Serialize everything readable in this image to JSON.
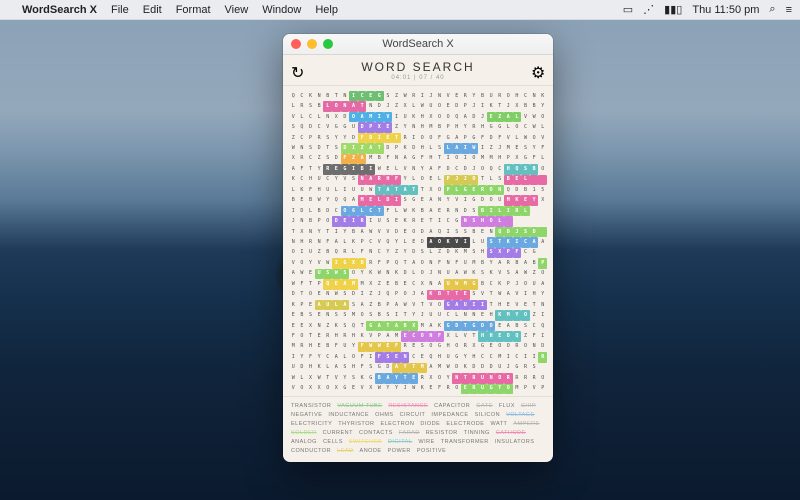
{
  "menubar": {
    "apple_glyph": "",
    "app_name": "WordSearch X",
    "menus": [
      "File",
      "Edit",
      "Format",
      "View",
      "Window",
      "Help"
    ],
    "status_wifi": "⋰",
    "status_airplay": "▭",
    "status_battery": "▮▮▯",
    "status_time": "Thu 11:50 pm",
    "status_search": "⌕",
    "status_menu": "≡"
  },
  "window": {
    "title": "WordSearch X",
    "toolbar_title": "WORD SEARCH",
    "toolbar_sub": "04:01  |  07 / 40",
    "refresh_icon": "↻",
    "gear_icon": "⚙"
  },
  "grid": {
    "cols": 30,
    "rows_text": [
      "QCKNBTNICEGSZWRIJNVERYBUROHCNKE",
      "LRSBLONATNDJZXLWUOEDPJIKTJXBBYU",
      "VLCLNXDOAMIVIUKHXOOQADJEZALVWOQOQCU",
      "SQDCVGGUDPXEZYNHMBPHYRHGGLOCWLPR",
      "ZCPRSYYDFDIETRIOOFGAPGFDFVLWOVHUUX",
      "WNSDTSDIZATDPKDHLSLAIWIZJMESYFVTOU",
      "XRCZSDFZAMBFNAGFHTIOIOMMHPXGFLA",
      "AFTYREGIBIWELVNYAFDCDJOQCHQSBOUL",
      "KCHUCYVSNARHFYLOELPJJOTLSBEL",
      "LKFHULIUUWTATATTXOPLGERONQDB15FZ",
      "BEBWYQQAMELDISGEANYVIGDOUMKEYXTJ",
      "IDLBDCO6LCTFLWKBAERNDSBILIRL",
      "JNBPODEIRIUSEKRETICGNSHOL",
      "TXNYTIYBAWVVDEODAQISSBENQDJSD",
      "NHRNFALKPCVQYLEDAOKVILUSTKICAA",
      "OIUZBQRLFNCYZYDSLZDKMSHSXPFCG",
      "VOYVWIGXDRFPQTAONFNFUMBYARBABP",
      "AWEUSWSOYKWNKDLOJNUAWKSKVSAWZOF",
      "WFTPQEAMMXZEBECXNAUWMGBCKPJOUA",
      "DTOENWSDIZJQPOJAKBTTESVTWAVIHY",
      "KPEAULASAZBPAWVTVOGAUIITHEVETNR",
      "EBSENSSMOSBSITYJUUCLNNEHKMYOZIY",
      "EEXNZKSQTGATABXMAKGDTGDOEABSCQ",
      "FOTERHRHKVPAMECONFXLVTHHEOQZFIT",
      "MRHEBFUYFWWEFRESOGHORXGEOORONDGGJG",
      "IYFYCALOFIFSENCEQHUGYHCCMICIIRH",
      "UDHKLASHFSGDAYTMAMWDKDDDUJGRS",
      "WLXWTVYSKGBAYTERXOYNTRUNORRRROB",
      "VOXXOXGEVXWYYJWKEFROERUGTOMPVP"
    ],
    "highlights": [
      {
        "row": 0,
        "col": 7,
        "len": 4,
        "color": "#6fbf73"
      },
      {
        "row": 1,
        "col": 4,
        "len": 5,
        "color": "#e36aa5"
      },
      {
        "row": 2,
        "col": 7,
        "len": 5,
        "color": "#4fb0e6"
      },
      {
        "row": 2,
        "col": 23,
        "len": 4,
        "color": "#7fcf66"
      },
      {
        "row": 3,
        "col": 8,
        "len": 4,
        "color": "#a37de6"
      },
      {
        "row": 4,
        "col": 8,
        "len": 5,
        "color": "#f0d24a"
      },
      {
        "row": 5,
        "col": 6,
        "len": 5,
        "color": "#9ed96a"
      },
      {
        "row": 5,
        "col": 18,
        "len": 4,
        "color": "#6aa8e0"
      },
      {
        "row": 6,
        "col": 6,
        "len": 3,
        "color": "#f0b04a"
      },
      {
        "row": 7,
        "col": 4,
        "len": 6,
        "color": "#6e6e6e"
      },
      {
        "row": 7,
        "col": 25,
        "len": 4,
        "color": "#63c0c0"
      },
      {
        "row": 8,
        "col": 8,
        "len": 5,
        "color": "#e86aa5"
      },
      {
        "row": 8,
        "col": 18,
        "len": 4,
        "color": "#d6ca55"
      },
      {
        "row": 8,
        "col": 25,
        "len": 5,
        "color": "#e86aa5"
      },
      {
        "row": 9,
        "col": 10,
        "len": 5,
        "color": "#63c0c0"
      },
      {
        "row": 9,
        "col": 18,
        "len": 7,
        "color": "#8fd66a"
      },
      {
        "row": 10,
        "col": 8,
        "len": 5,
        "color": "#e86aa5"
      },
      {
        "row": 10,
        "col": 25,
        "len": 4,
        "color": "#e86aa5"
      },
      {
        "row": 11,
        "col": 6,
        "len": 5,
        "color": "#6aa8e0"
      },
      {
        "row": 11,
        "col": 22,
        "len": 6,
        "color": "#8fd66a"
      },
      {
        "row": 12,
        "col": 5,
        "len": 4,
        "color": "#a37de6"
      },
      {
        "row": 12,
        "col": 20,
        "len": 6,
        "color": "#d07de0"
      },
      {
        "row": 13,
        "col": 24,
        "len": 6,
        "color": "#8fd66a"
      },
      {
        "row": 14,
        "col": 16,
        "len": 5,
        "color": "#4a4a4a"
      },
      {
        "row": 14,
        "col": 23,
        "len": 6,
        "color": "#6aa8e0"
      },
      {
        "row": 15,
        "col": 23,
        "len": 4,
        "color": "#a37de6"
      },
      {
        "row": 16,
        "col": 5,
        "len": 4,
        "color": "#f0d24a"
      },
      {
        "row": 16,
        "col": 29,
        "len": 1,
        "color": "#8fd66a"
      },
      {
        "row": 17,
        "col": 3,
        "len": 4,
        "color": "#8fd66a"
      },
      {
        "row": 18,
        "col": 4,
        "len": 4,
        "color": "#f0d24a"
      },
      {
        "row": 18,
        "col": 18,
        "len": 4,
        "color": "#e3c64a"
      },
      {
        "row": 19,
        "col": 16,
        "len": 5,
        "color": "#e86aa5"
      },
      {
        "row": 20,
        "col": 3,
        "len": 4,
        "color": "#d6ca55"
      },
      {
        "row": 20,
        "col": 18,
        "len": 5,
        "color": "#a37de6"
      },
      {
        "row": 21,
        "col": 24,
        "len": 4,
        "color": "#63c0c0"
      },
      {
        "row": 22,
        "col": 9,
        "len": 6,
        "color": "#8fd66a"
      },
      {
        "row": 22,
        "col": 18,
        "len": 6,
        "color": "#6aa8e0"
      },
      {
        "row": 23,
        "col": 13,
        "len": 5,
        "color": "#d07de0"
      },
      {
        "row": 23,
        "col": 22,
        "len": 5,
        "color": "#63c0c0"
      },
      {
        "row": 24,
        "col": 8,
        "len": 5,
        "color": "#e3c64a"
      },
      {
        "row": 25,
        "col": 10,
        "len": 4,
        "color": "#a37de6"
      },
      {
        "row": 25,
        "col": 29,
        "len": 1,
        "color": "#8fd66a"
      },
      {
        "row": 26,
        "col": 12,
        "len": 4,
        "color": "#e3c64a"
      },
      {
        "row": 27,
        "col": 10,
        "len": 5,
        "color": "#6aa8e0"
      },
      {
        "row": 27,
        "col": 19,
        "len": 7,
        "color": "#e86aa5"
      },
      {
        "row": 28,
        "col": 20,
        "len": 6,
        "color": "#8fd66a"
      }
    ]
  },
  "palette": {
    "pink": "#e86aa5",
    "green": "#8fd66a",
    "blue": "#6aa8e0",
    "yellow": "#e3c64a",
    "purple": "#a37de6",
    "teal": "#63c0c0",
    "grey": "#6e6e6e",
    "orange": "#f0b04a",
    "magenta": "#d07de0",
    "gold": "#f0d24a"
  },
  "words": [
    {
      "label": "TRANSISTOR",
      "found": false,
      "color": "#777"
    },
    {
      "label": "VACUUM TUBE",
      "found": true,
      "color": "#6fbf73"
    },
    {
      "label": "RESISTANCE",
      "found": true,
      "color": "#e86aa5"
    },
    {
      "label": "CAPACITOR",
      "found": false,
      "color": "#777"
    },
    {
      "label": "GATE",
      "found": true,
      "color": "#a0a0a0"
    },
    {
      "label": "FLUX",
      "found": false,
      "color": "#777"
    },
    {
      "label": "CHIP",
      "found": true,
      "color": "#a0a0a0"
    },
    {
      "label": "NEGATIVE",
      "found": false,
      "color": "#777"
    },
    {
      "label": "INDUCTANCE",
      "found": false,
      "color": "#777"
    },
    {
      "label": "OHMS",
      "found": false,
      "color": "#777"
    },
    {
      "label": "CIRCUIT",
      "found": false,
      "color": "#777"
    },
    {
      "label": "IMPEDANCE",
      "found": false,
      "color": "#777"
    },
    {
      "label": "SILICON",
      "found": false,
      "color": "#777"
    },
    {
      "label": "VOLTAGE",
      "found": true,
      "color": "#6aa8e0"
    },
    {
      "label": "ELECTRICITY",
      "found": false,
      "color": "#777"
    },
    {
      "label": "THYRISTOR",
      "found": false,
      "color": "#777"
    },
    {
      "label": "ELECTRON",
      "found": false,
      "color": "#777"
    },
    {
      "label": "DIODE",
      "found": false,
      "color": "#777"
    },
    {
      "label": "ELECTRODE",
      "found": false,
      "color": "#777"
    },
    {
      "label": "WATT",
      "found": false,
      "color": "#777"
    },
    {
      "label": "AMPERE",
      "found": true,
      "color": "#a0a0a0"
    },
    {
      "label": "SOLDER",
      "found": true,
      "color": "#8fd66a"
    },
    {
      "label": "CURRENT",
      "found": false,
      "color": "#777"
    },
    {
      "label": "CONTACTS",
      "found": false,
      "color": "#777"
    },
    {
      "label": "FARAD",
      "found": true,
      "color": "#a0a0a0"
    },
    {
      "label": "RESISTOR",
      "found": false,
      "color": "#777"
    },
    {
      "label": "TINNING",
      "found": false,
      "color": "#777"
    },
    {
      "label": "CATHODE",
      "found": true,
      "color": "#e86aa5"
    },
    {
      "label": "ANALOG",
      "found": false,
      "color": "#777"
    },
    {
      "label": "CELLS",
      "found": false,
      "color": "#777"
    },
    {
      "label": "SWITCHES",
      "found": true,
      "color": "#f0d24a"
    },
    {
      "label": "DIGITAL",
      "found": true,
      "color": "#63c0c0"
    },
    {
      "label": "WIRE",
      "found": false,
      "color": "#777"
    },
    {
      "label": "TRANSFORMER",
      "found": false,
      "color": "#777"
    },
    {
      "label": "INSULATORS",
      "found": false,
      "color": "#777"
    },
    {
      "label": "CONDUCTOR",
      "found": false,
      "color": "#777"
    },
    {
      "label": "LEAD",
      "found": true,
      "color": "#e3c64a"
    },
    {
      "label": "ANODE",
      "found": false,
      "color": "#777"
    },
    {
      "label": "POWER",
      "found": false,
      "color": "#777"
    },
    {
      "label": "POSITIVE",
      "found": false,
      "color": "#777"
    }
  ]
}
